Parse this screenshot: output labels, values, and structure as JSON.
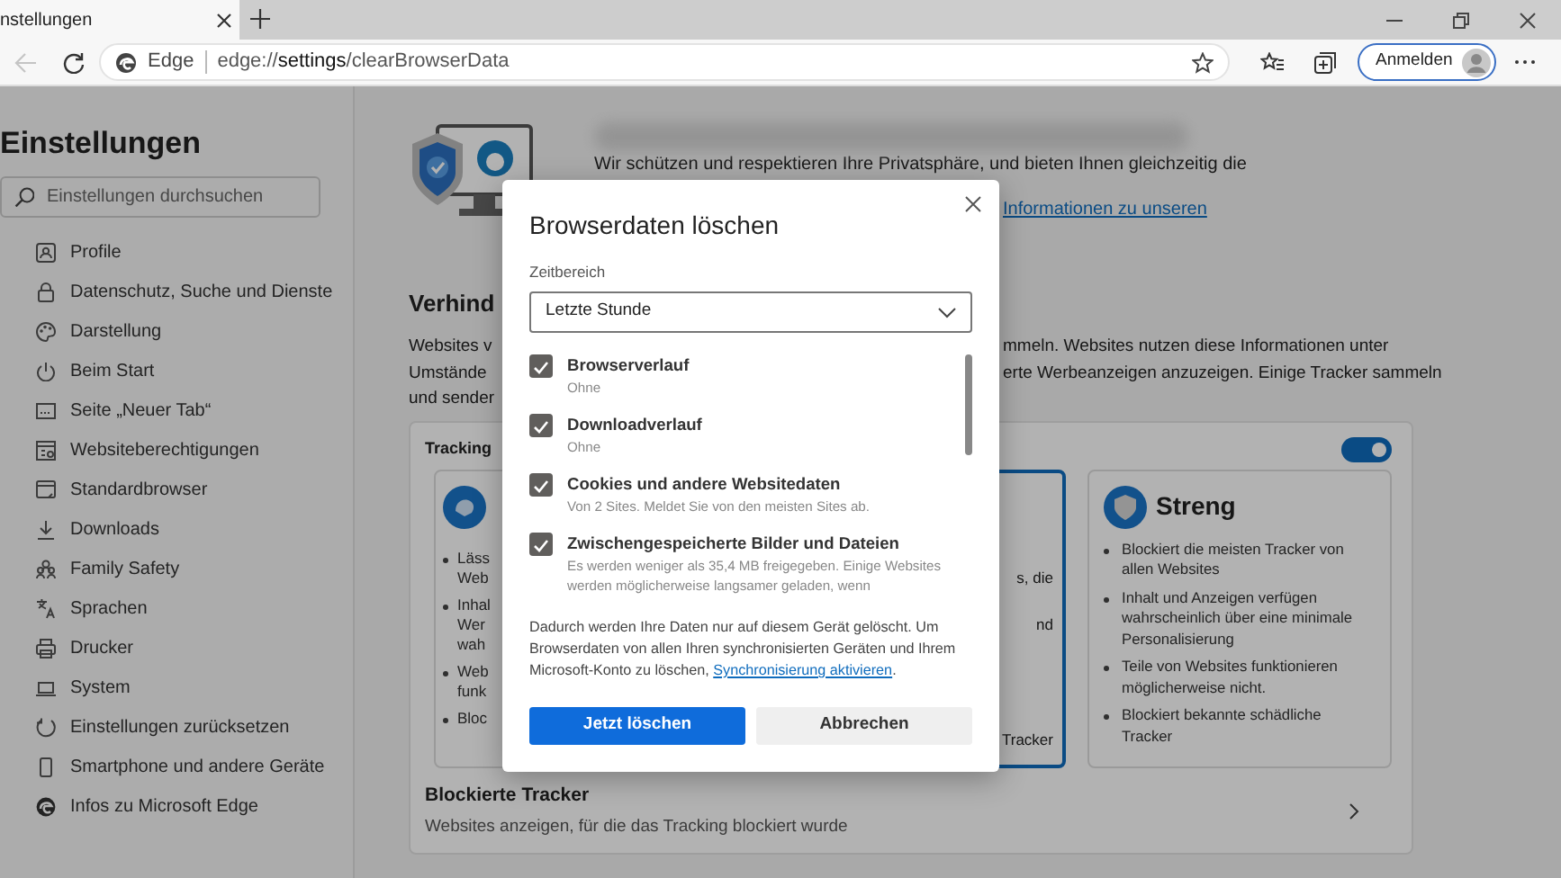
{
  "tab": {
    "title": "nstellungen"
  },
  "toolbar": {
    "back_disabled": true,
    "site_label": "Edge",
    "url_prefix": "edge://",
    "url_bold": "settings",
    "url_suffix": "/clearBrowserData",
    "signin": "Anmelden"
  },
  "sidebar": {
    "title": "Einstellungen",
    "search_placeholder": "Einstellungen durchsuchen",
    "items": [
      {
        "label": "Profile"
      },
      {
        "label": "Datenschutz, Suche und Dienste"
      },
      {
        "label": "Darstellung"
      },
      {
        "label": "Beim Start"
      },
      {
        "label": "Seite „Neuer Tab“"
      },
      {
        "label": "Websiteberechtigungen"
      },
      {
        "label": "Standardbrowser"
      },
      {
        "label": "Downloads"
      },
      {
        "label": "Family Safety"
      },
      {
        "label": "Sprachen"
      },
      {
        "label": "Drucker"
      },
      {
        "label": "System"
      },
      {
        "label": "Einstellungen zurücksetzen"
      },
      {
        "label": "Smartphone und andere Geräte"
      },
      {
        "label": "Infos zu Microsoft Edge"
      }
    ]
  },
  "main": {
    "intro": "Wir schützen und respektieren Ihre Privatsphäre, und bieten Ihnen gleichzeitig die",
    "intro_link": "Informationen zu unseren",
    "heading": "Verhind",
    "text_rows": [
      {
        "left": "Websites v",
        "right": "mmeln. Websites nutzen diese Informationen unter"
      },
      {
        "left": "Umstände",
        "right": "erte Werbeanzeigen anzuzeigen. Einige Tracker sammeln"
      },
      {
        "left": "und sender"
      }
    ],
    "tracking": {
      "title": "Tracking",
      "enabled": true,
      "cards": [
        {
          "kind": "left",
          "selected": false,
          "bullets": [
            [
              "Läss",
              "Web"
            ],
            [
              "Inhal",
              "Wer",
              "wah"
            ],
            [
              "Web",
              "funk"
            ],
            [
              "Bloc"
            ]
          ]
        },
        {
          "kind": "middle",
          "selected": true,
          "fragments": [
            "s, die",
            "nd",
            "Tracker"
          ]
        },
        {
          "kind": "right",
          "selected": false,
          "title": "Streng",
          "bullets": [
            "Blockiert die meisten Tracker von allen Websites",
            "Inhalt und Anzeigen verfügen wahrscheinlich über eine minimale Personalisierung",
            "Teile von Websites funktionieren möglicherweise nicht.",
            "Blockiert bekannte schädliche Tracker"
          ]
        }
      ]
    },
    "blocked": {
      "title": "Blockierte Tracker",
      "subtitle": "Websites anzeigen, für die das Tracking blockiert wurde"
    }
  },
  "dialog": {
    "title": "Browserdaten löschen",
    "range_label": "Zeitbereich",
    "range_value": "Letzte Stunde",
    "options": [
      {
        "label": "Browserverlauf",
        "detail": "Ohne",
        "checked": true
      },
      {
        "label": "Downloadverlauf",
        "detail": "Ohne",
        "checked": true
      },
      {
        "label": "Cookies und andere Websitedaten",
        "detail": "Von 2 Sites. Meldet Sie von den meisten Sites ab.",
        "checked": true
      },
      {
        "label": "Zwischengespeicherte Bilder und Dateien",
        "detail": "Es werden weniger als 35,4 MB freigegeben. Einige Websites werden möglicherweise langsamer geladen, wenn",
        "checked": true
      }
    ],
    "note": {
      "text": "Dadurch werden Ihre Daten nur auf diesem Gerät gelöscht. Um Browserdaten von allen Ihren synchronisierten Geräten und Ihrem Microsoft-Konto zu löschen, ",
      "link": "Synchronisierung aktivieren",
      "after": "."
    },
    "buttons": [
      {
        "label": "Jetzt löschen",
        "kind": "primary"
      },
      {
        "label": "Abbrechen",
        "kind": "secondary"
      }
    ]
  }
}
